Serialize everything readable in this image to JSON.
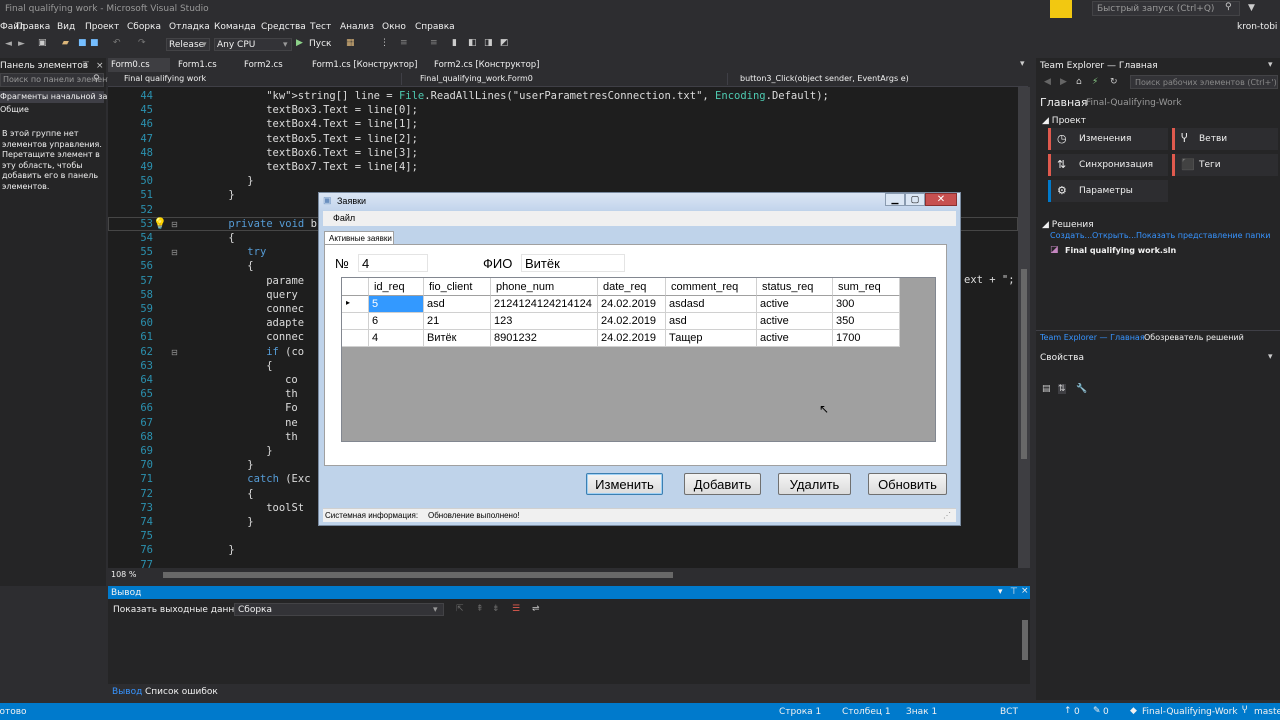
{
  "window": {
    "title": "Final qualifying work - Microsoft Visual Studio",
    "quick_launch": "Быстрый запуск (Ctrl+Q)",
    "user": "kron-tobi"
  },
  "menu": [
    "Файл",
    "Правка",
    "Вид",
    "Проект",
    "Сборка",
    "Отладка",
    "Команда",
    "Средства",
    "Тест",
    "Анализ",
    "Окно",
    "Справка"
  ],
  "toolbar": {
    "config": "Release",
    "platform": "Any CPU",
    "run": "Пуск"
  },
  "toolbox": {
    "search_placeholder": "Поиск по панели элементов",
    "group": "Фрагменты начальной заг...",
    "general": "Общие",
    "empty_text": "В этой группе нет элементов управления. Перетащите элемент в эту область, чтобы добавить его в панель элементов."
  },
  "toolbox_title": "Панель элементов",
  "tabs": [
    "Form0.cs",
    "Form1.cs",
    "Form2.cs",
    "Form1.cs [Конструктор]",
    "Form2.cs [Конструктор]"
  ],
  "navbar": {
    "project": "Final qualifying work",
    "class": "Final_qualifying_work.Form0",
    "member": "button3_Click(object sender, EventArgs e)"
  },
  "code_lines": [
    {
      "n": "44",
      "ind": 14,
      "text": "string[] line = File.ReadAllLines(\"userParametresConnection.txt\", Encoding.Default);"
    },
    {
      "n": "45",
      "ind": 14,
      "text": "textBox3.Text = line[0];"
    },
    {
      "n": "46",
      "ind": 14,
      "text": "textBox4.Text = line[1];"
    },
    {
      "n": "47",
      "ind": 14,
      "text": "textBox5.Text = line[2];"
    },
    {
      "n": "48",
      "ind": 14,
      "text": "textBox6.Text = line[3];"
    },
    {
      "n": "49",
      "ind": 14,
      "text": "textBox7.Text = line[4];"
    },
    {
      "n": "50",
      "ind": 11,
      "text": "}"
    },
    {
      "n": "51",
      "ind": 8,
      "text": "}"
    },
    {
      "n": "52",
      "ind": 0,
      "text": ""
    },
    {
      "n": "53",
      "ind": 8,
      "text": "private void b"
    },
    {
      "n": "54",
      "ind": 8,
      "text": "{"
    },
    {
      "n": "55",
      "ind": 11,
      "text": "try"
    },
    {
      "n": "56",
      "ind": 11,
      "text": "{"
    },
    {
      "n": "57",
      "ind": 14,
      "text": "parame"
    },
    {
      "n": "58",
      "ind": 14,
      "text": "query"
    },
    {
      "n": "59",
      "ind": 14,
      "text": "connec"
    },
    {
      "n": "60",
      "ind": 14,
      "text": "adapte"
    },
    {
      "n": "61",
      "ind": 14,
      "text": "connec"
    },
    {
      "n": "62",
      "ind": 14,
      "text": "if (co"
    },
    {
      "n": "63",
      "ind": 14,
      "text": "{"
    },
    {
      "n": "64",
      "ind": 17,
      "text": "co"
    },
    {
      "n": "65",
      "ind": 17,
      "text": "th"
    },
    {
      "n": "66",
      "ind": 17,
      "text": "Fo"
    },
    {
      "n": "67",
      "ind": 17,
      "text": "ne"
    },
    {
      "n": "68",
      "ind": 17,
      "text": "th"
    },
    {
      "n": "69",
      "ind": 14,
      "text": "}"
    },
    {
      "n": "70",
      "ind": 11,
      "text": "}"
    },
    {
      "n": "71",
      "ind": 11,
      "text": "catch (Exc"
    },
    {
      "n": "72",
      "ind": 11,
      "text": "{"
    },
    {
      "n": "73",
      "ind": 14,
      "text": "toolSt"
    },
    {
      "n": "74",
      "ind": 11,
      "text": "}"
    },
    {
      "n": "75",
      "ind": 0,
      "text": ""
    },
    {
      "n": "76",
      "ind": 8,
      "text": "}"
    },
    {
      "n": "77",
      "ind": 0,
      "text": ""
    }
  ],
  "code_right_fragment": "ext + \";",
  "zoom": "108 %",
  "team_explorer": {
    "title": "Team Explorer — Главная",
    "search_placeholder": "Поиск рабочих элементов (Ctrl+')",
    "home": "Главная",
    "repo": "Final-Qualifying-Work",
    "project_section": "Проект",
    "buttons": [
      "Изменения",
      "Ветви",
      "Синхронизация",
      "Теги",
      "Параметры"
    ],
    "solutions_section": "Решения",
    "links": [
      "Создать...",
      "Открыть...",
      "Показать представление папки"
    ],
    "solution": "Final qualifying work.sln",
    "bottom_tabs": [
      "Team Explorer — Главная",
      "Обозреватель решений"
    ]
  },
  "properties": {
    "title": "Свойства"
  },
  "output": {
    "title": "Вывод",
    "show_label": "Показать выходные данные из:",
    "source": "Сборка",
    "tabs": [
      "Вывод",
      "Список ошибок"
    ]
  },
  "status": {
    "ready": "Готово",
    "line": "Строка 1",
    "col": "Столбец 1",
    "char": "Знак 1",
    "ins": "ВСТ",
    "errors": "0",
    "repo": "Final-Qualifying-Work",
    "branch": "master"
  },
  "dialog": {
    "title": "Заявки",
    "menu": "Файл",
    "tab": "Активные заявки",
    "num_label": "№",
    "num_value": "4",
    "fio_label": "ФИО",
    "fio_value": "Витёк",
    "columns": [
      "id_req",
      "fio_client",
      "phone_num",
      "date_req",
      "comment_req",
      "status_req",
      "sum_req"
    ],
    "rows": [
      [
        "5",
        "asd",
        "2124124124214124",
        "24.02.2019",
        "asdasd",
        "active",
        "300"
      ],
      [
        "6",
        "21",
        "123",
        "24.02.2019",
        "asd",
        "active",
        "350"
      ],
      [
        "4",
        "Витёк",
        "8901232",
        "24.02.2019",
        "Тащер",
        "active",
        "1700"
      ]
    ],
    "buttons": [
      "Изменить",
      "Добавить",
      "Удалить",
      "Обновить"
    ],
    "status_label": "Системная информация:",
    "status_value": "Обновление выполнено!"
  },
  "colors": {
    "vs_bg": "#2d2d30",
    "editor_bg": "#1e1e1e",
    "accent": "#007acc",
    "keyword": "#569cd6",
    "string": "#d69d85",
    "line_number": "#2b91af"
  }
}
